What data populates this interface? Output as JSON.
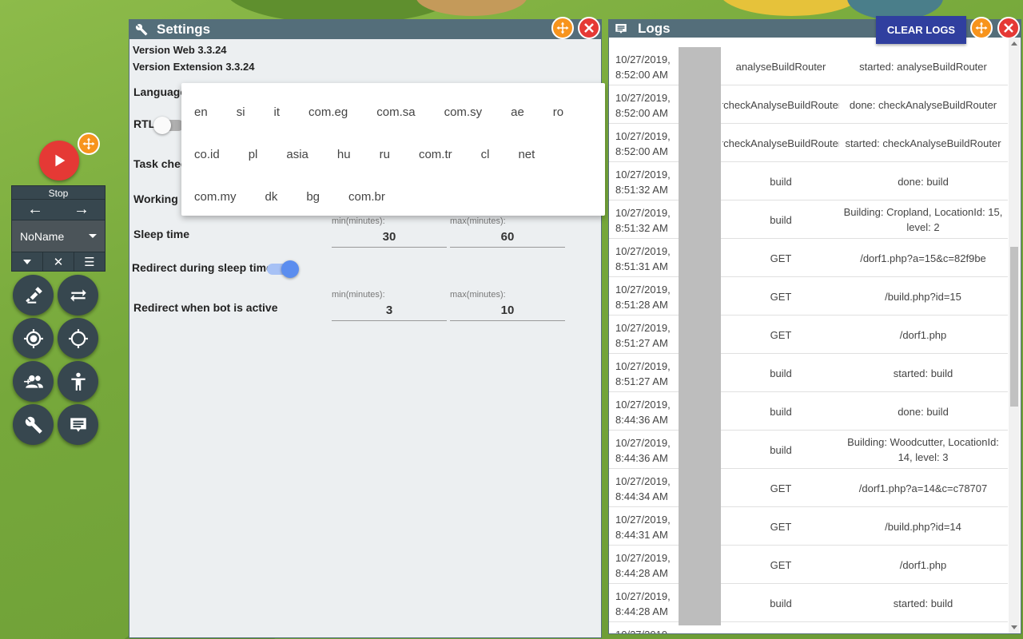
{
  "bot": {
    "stop_label": "Stop",
    "profile_name": "NoName"
  },
  "settings": {
    "title": "Settings",
    "version_web": "Version Web 3.3.24",
    "version_extension": "Version Extension 3.3.24",
    "language_label": "Language",
    "rtl_label": "RTL",
    "rtl_enabled": false,
    "task_check_label": "Task chec",
    "working_label": "Working c",
    "sleep_time": {
      "label": "Sleep time",
      "min_label": "min(minutes):",
      "min_value": "30",
      "max_label": "max(minutes):",
      "max_value": "60"
    },
    "redirect_sleep": {
      "label": "Redirect during sleep time",
      "enabled": true
    },
    "redirect_active": {
      "label": "Redirect when bot is active",
      "min_label": "min(minutes):",
      "min_value": "3",
      "max_label": "max(minutes):",
      "max_value": "10"
    }
  },
  "language_dropdown": {
    "rows": [
      [
        "en",
        "si",
        "it",
        "com.eg",
        "com.sa",
        "com.sy",
        "ae",
        "ro"
      ],
      [
        "co.id",
        "pl",
        "asia",
        "hu",
        "ru",
        "com.tr",
        "cl",
        "net"
      ],
      [
        "com.my",
        "dk",
        "bg",
        "com.br"
      ]
    ]
  },
  "logs": {
    "title": "Logs",
    "clear_label": "CLEAR LOGS",
    "rows": [
      {
        "date": "10/27/2019, 8:52:00 AM",
        "type": "analyseBuildRouter",
        "message": "started: analyseBuildRouter"
      },
      {
        "date": "10/27/2019, 8:52:00 AM",
        "type": "rcheckAnalyseBuildRouter",
        "message": "done: checkAnalyseBuildRouter"
      },
      {
        "date": "10/27/2019, 8:52:00 AM",
        "type": "rcheckAnalyseBuildRouter",
        "message": "started: checkAnalyseBuildRouter"
      },
      {
        "date": "10/27/2019, 8:51:32 AM",
        "type": "build",
        "message": "done: build"
      },
      {
        "date": "10/27/2019, 8:51:32 AM",
        "type": "build",
        "message": "Building: Cropland, LocationId: 15, level: 2"
      },
      {
        "date": "10/27/2019, 8:51:31 AM",
        "type": "GET",
        "message": "/dorf1.php?a=15&c=82f9be"
      },
      {
        "date": "10/27/2019, 8:51:28 AM",
        "type": "GET",
        "message": "/build.php?id=15"
      },
      {
        "date": "10/27/2019, 8:51:27 AM",
        "type": "GET",
        "message": "/dorf1.php"
      },
      {
        "date": "10/27/2019, 8:51:27 AM",
        "type": "build",
        "message": "started: build"
      },
      {
        "date": "10/27/2019, 8:44:36 AM",
        "type": "build",
        "message": "done: build"
      },
      {
        "date": "10/27/2019, 8:44:36 AM",
        "type": "build",
        "message": "Building: Woodcutter, LocationId: 14, level: 3"
      },
      {
        "date": "10/27/2019, 8:44:34 AM",
        "type": "GET",
        "message": "/dorf1.php?a=14&c=c78707"
      },
      {
        "date": "10/27/2019, 8:44:31 AM",
        "type": "GET",
        "message": "/build.php?id=14"
      },
      {
        "date": "10/27/2019, 8:44:28 AM",
        "type": "GET",
        "message": "/dorf1.php"
      },
      {
        "date": "10/27/2019, 8:44:28 AM",
        "type": "build",
        "message": "started: build"
      },
      {
        "date": "10/27/2019",
        "type": "",
        "message": ""
      }
    ]
  }
}
